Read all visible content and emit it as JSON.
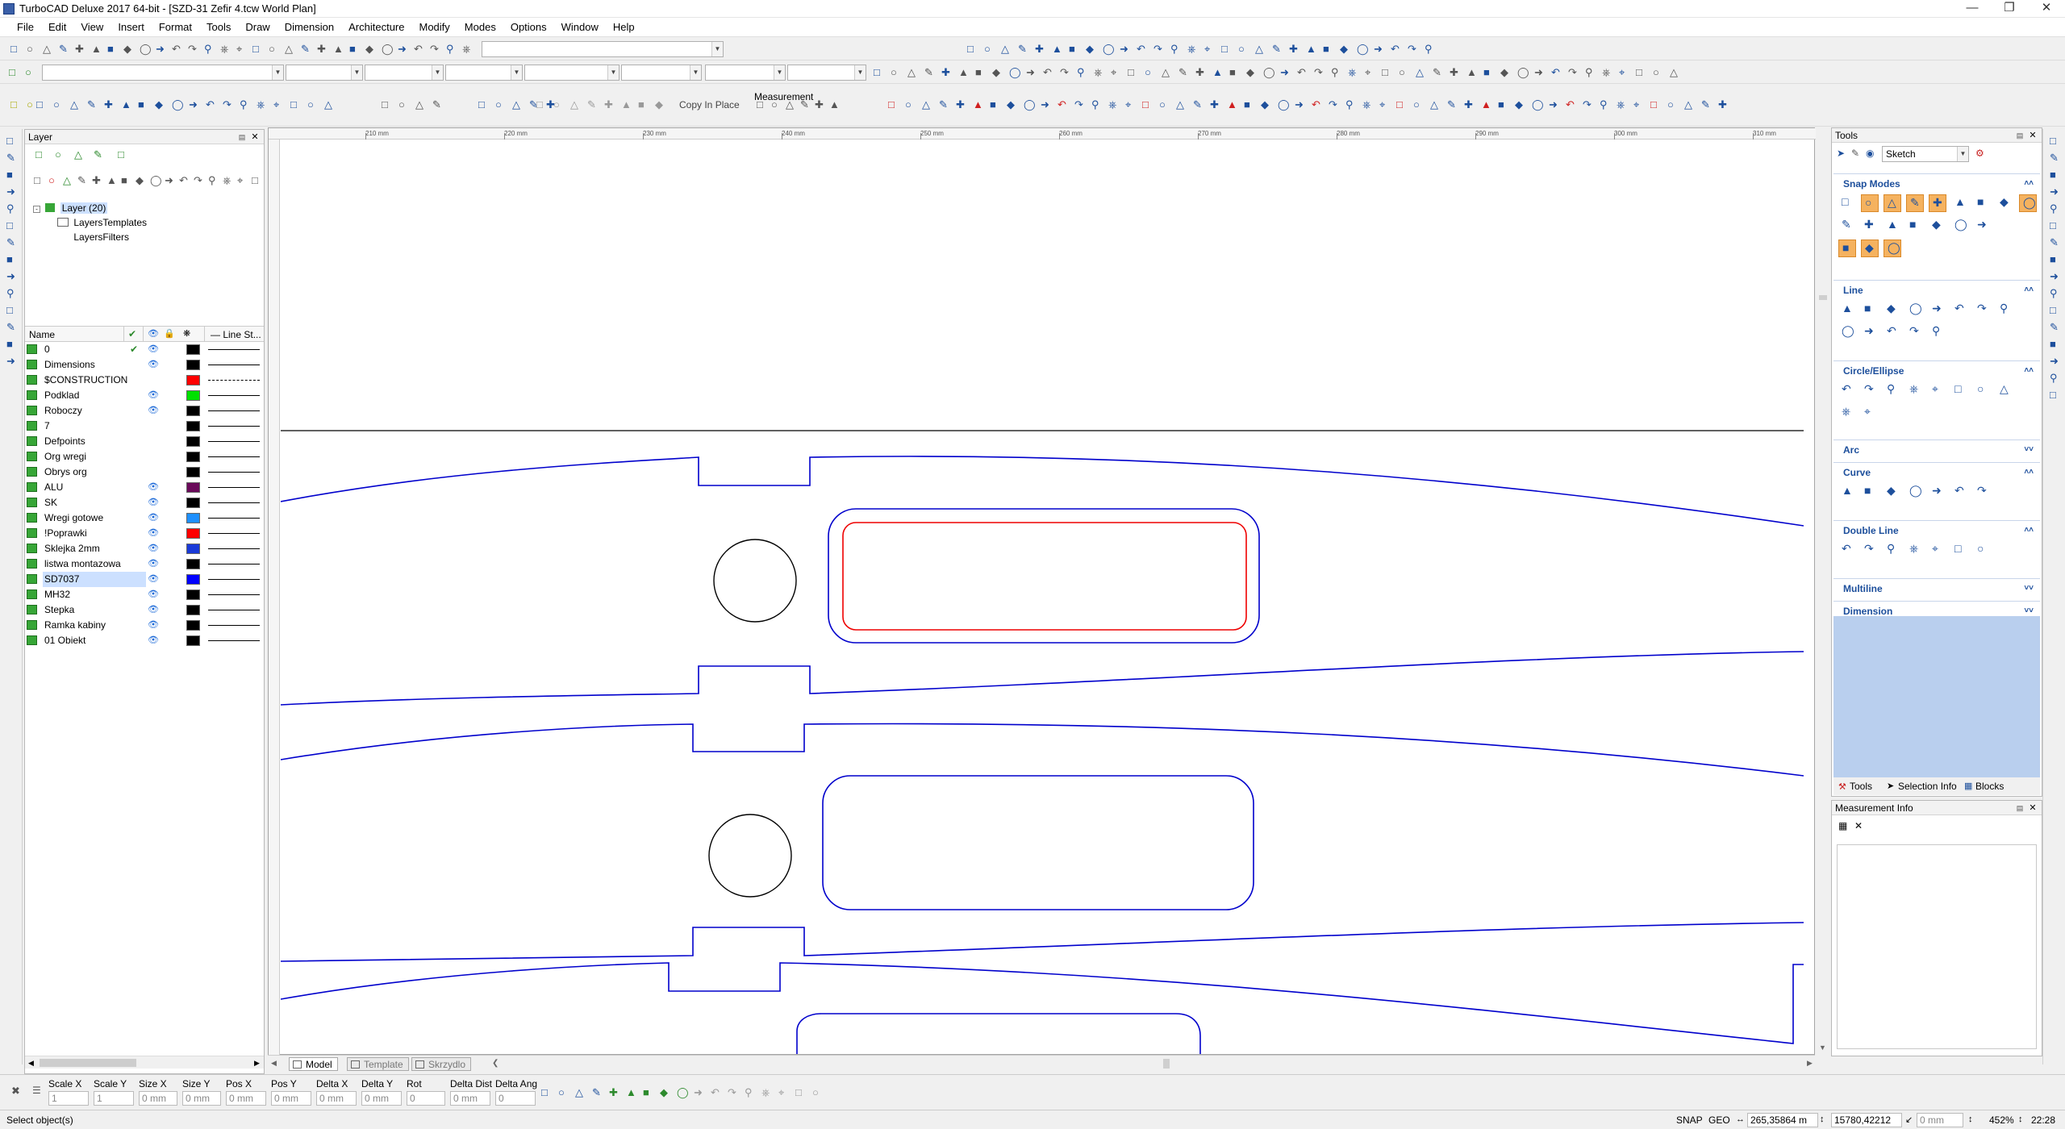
{
  "window": {
    "title": "TurboCAD Deluxe 2017 64-bit - [SZD-31 Zefir 4.tcw World Plan]"
  },
  "menu": [
    "File",
    "Edit",
    "View",
    "Insert",
    "Format",
    "Tools",
    "Draw",
    "Dimension",
    "Architecture",
    "Modify",
    "Modes",
    "Options",
    "Window",
    "Help"
  ],
  "toolbar": {
    "copy_in_place": "Copy In Place",
    "measurement_label": "Measurement"
  },
  "layer_panel": {
    "title": "Layer",
    "tree": {
      "root": "Layer (20)",
      "children": [
        "LayersTemplates",
        "LayersFilters"
      ]
    },
    "columns": {
      "name": "Name",
      "line_style": "Line St..."
    },
    "layers": [
      {
        "name": "0",
        "current": true,
        "visible": true,
        "color": "#000000",
        "line": "solid"
      },
      {
        "name": "Dimensions",
        "current": false,
        "visible": true,
        "color": "#000000",
        "line": "solid"
      },
      {
        "name": "$CONSTRUCTION",
        "current": false,
        "visible": false,
        "color": "#ff0000",
        "line": "dashdot"
      },
      {
        "name": "Podklad",
        "current": false,
        "visible": true,
        "color": "#00e000",
        "line": "solid"
      },
      {
        "name": "Roboczy",
        "current": false,
        "visible": true,
        "color": "#000000",
        "line": "solid"
      },
      {
        "name": "7",
        "current": false,
        "visible": false,
        "color": "#000000",
        "line": "solid"
      },
      {
        "name": "Defpoints",
        "current": false,
        "visible": false,
        "color": "#000000",
        "line": "solid"
      },
      {
        "name": "Org wregi",
        "current": false,
        "visible": false,
        "color": "#000000",
        "line": "solid"
      },
      {
        "name": "Obrys org",
        "current": false,
        "visible": false,
        "color": "#000000",
        "line": "solid"
      },
      {
        "name": "ALU",
        "current": false,
        "visible": true,
        "color": "#6a0a5a",
        "line": "solid"
      },
      {
        "name": "SK",
        "current": false,
        "visible": true,
        "color": "#000000",
        "line": "solid"
      },
      {
        "name": "Wregi gotowe",
        "current": false,
        "visible": true,
        "color": "#1e90ff",
        "line": "solid"
      },
      {
        "name": "!Poprawki",
        "current": false,
        "visible": true,
        "color": "#ff0000",
        "line": "solid"
      },
      {
        "name": "Sklejka 2mm",
        "current": false,
        "visible": true,
        "color": "#1a3ad8",
        "line": "solid"
      },
      {
        "name": "listwa montazowa",
        "current": false,
        "visible": true,
        "color": "#000000",
        "line": "solid"
      },
      {
        "name": "SD7037",
        "current": false,
        "visible": true,
        "color": "#0000ff",
        "line": "solid",
        "selected": true
      },
      {
        "name": "MH32",
        "current": false,
        "visible": true,
        "color": "#000000",
        "line": "solid"
      },
      {
        "name": "Stepka",
        "current": false,
        "visible": true,
        "color": "#000000",
        "line": "solid"
      },
      {
        "name": "Ramka kabiny",
        "current": false,
        "visible": true,
        "color": "#000000",
        "line": "solid"
      },
      {
        "name": "01 Obiekt",
        "current": false,
        "visible": true,
        "color": "#000000",
        "line": "solid"
      }
    ]
  },
  "ruler": {
    "h_labels": [
      "210 mm",
      "220 mm",
      "230 mm",
      "240 mm",
      "250 mm",
      "260 mm",
      "270 mm",
      "280 mm",
      "290 mm",
      "300 mm",
      "310 mm"
    ]
  },
  "tabs": [
    "Model",
    "Template",
    "Skrzydlo"
  ],
  "tools_panel": {
    "title": "Tools",
    "mode": "Sketch",
    "sections": [
      "Snap Modes",
      "Line",
      "Circle/Ellipse",
      "Arc",
      "Curve",
      "Double Line",
      "Multiline",
      "Dimension"
    ],
    "bottom_tabs": [
      "Tools",
      "Selection Info",
      "Blocks"
    ]
  },
  "measurement_panel": {
    "title": "Measurement Info"
  },
  "input_bar": {
    "fields": [
      {
        "label": "Scale X",
        "value": "1"
      },
      {
        "label": "Scale Y",
        "value": "1"
      },
      {
        "label": "Size X",
        "value": "0 mm"
      },
      {
        "label": "Size Y",
        "value": "0 mm"
      },
      {
        "label": "Pos X",
        "value": "0 mm"
      },
      {
        "label": "Pos Y",
        "value": "0 mm"
      },
      {
        "label": "Delta X",
        "value": "0 mm"
      },
      {
        "label": "Delta Y",
        "value": "0 mm"
      },
      {
        "label": "Rot",
        "value": "0"
      },
      {
        "label": "Delta Dist",
        "value": "0 mm"
      },
      {
        "label": "Delta Ang",
        "value": "0"
      }
    ]
  },
  "status_bar": {
    "message": "Select object(s)",
    "snap": "SNAP",
    "geo": "GEO",
    "coord_x": "265,35864 m",
    "coord_y": "15780,42212",
    "length": "0 mm",
    "zoom": "452%",
    "time": "22:28"
  },
  "colors": {
    "profile_line": "#0000cc",
    "highlight_line": "#ee0000",
    "accent": "#1d4f9c"
  }
}
